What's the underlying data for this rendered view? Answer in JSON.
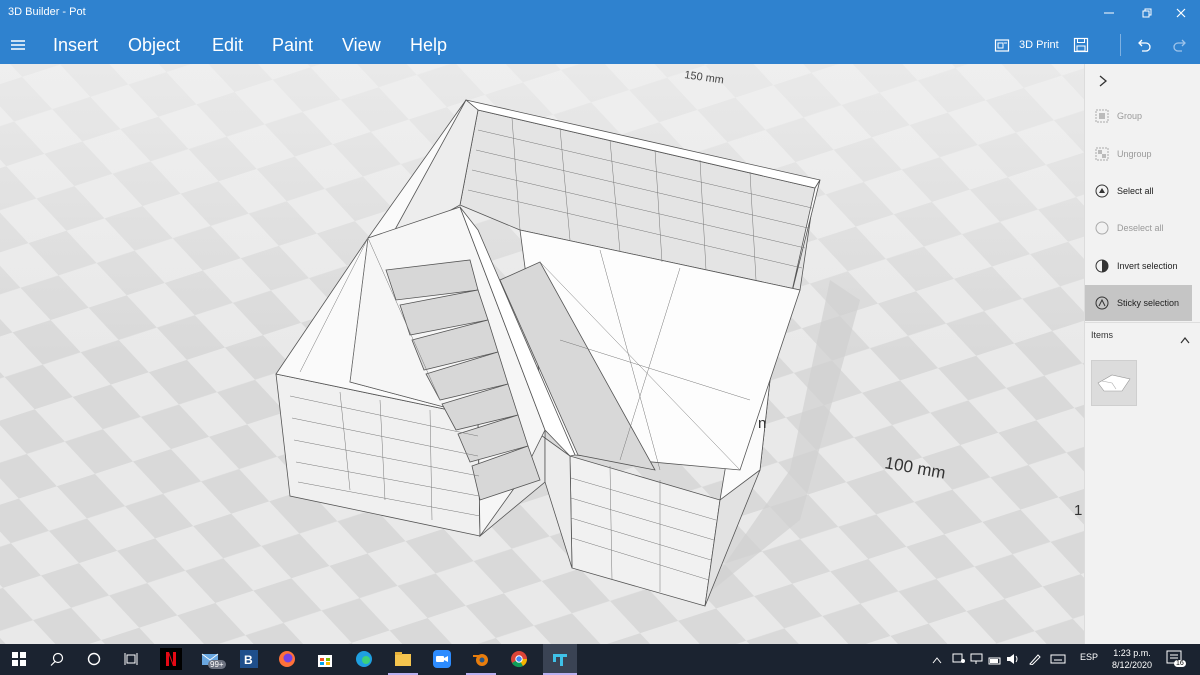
{
  "window": {
    "title": "3D Builder - Pot"
  },
  "menu": {
    "items": [
      "Insert",
      "Object",
      "Edit",
      "Paint",
      "View",
      "Help"
    ]
  },
  "toolbar": {
    "print_label": "3D Print"
  },
  "side_panel": {
    "items": [
      {
        "label": "Group",
        "enabled": false
      },
      {
        "label": "Ungroup",
        "enabled": false
      },
      {
        "label": "Select all",
        "enabled": true
      },
      {
        "label": "Deselect all",
        "enabled": false
      },
      {
        "label": "Invert selection",
        "enabled": true
      },
      {
        "label": "Sticky selection",
        "enabled": true,
        "active": true
      }
    ],
    "items_header": "Items"
  },
  "scene": {
    "dim_top": "150 mm",
    "dim_right": "100 mm",
    "dim_partial": "n",
    "dim_edge": "1"
  },
  "taskbar": {
    "mail_badge": "99+",
    "language": "ESP",
    "time": "1:23 p.m.",
    "date": "8/12/2020",
    "notification_count": "16"
  },
  "colors": {
    "accent": "#2f82cf",
    "taskbar": "#1b2330",
    "panel": "#f2f2f2"
  }
}
